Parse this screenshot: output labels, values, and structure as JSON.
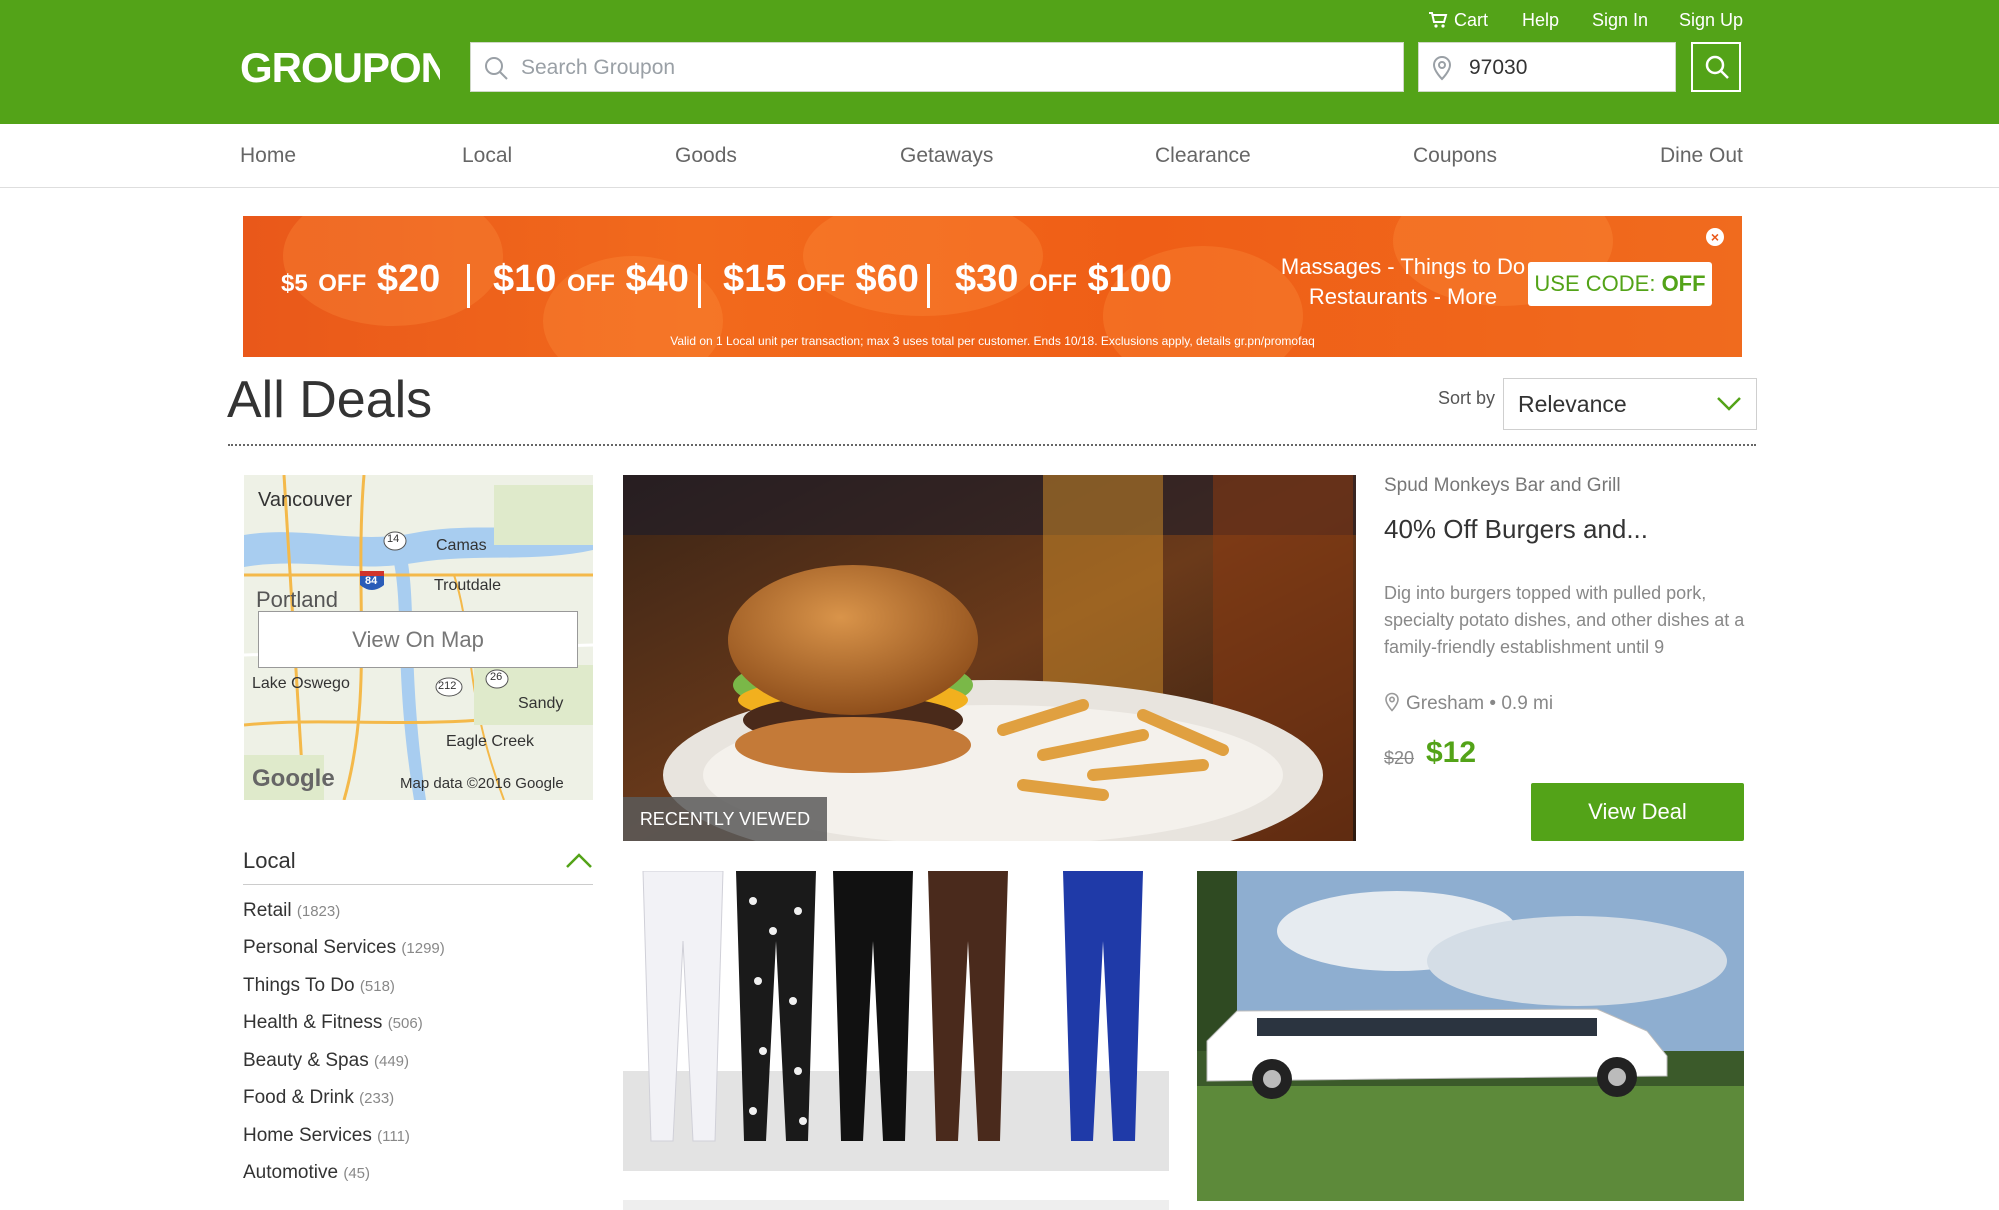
{
  "header": {
    "brand": "GROUPON",
    "cart_label": "Cart",
    "help_label": "Help",
    "signin_label": "Sign In",
    "signup_label": "Sign Up",
    "search_placeholder": "Search Groupon",
    "location_value": "97030",
    "brand_color": "#53a318"
  },
  "nav": {
    "items": [
      "Home",
      "Local",
      "Goods",
      "Getaways",
      "Clearance",
      "Coupons",
      "Dine Out"
    ]
  },
  "banner": {
    "offers": [
      {
        "off": "$5",
        "spend": "$20"
      },
      {
        "off": "$10",
        "spend": "$40"
      },
      {
        "off": "$15",
        "spend": "$60"
      },
      {
        "off": "$30",
        "spend": "$100"
      }
    ],
    "off_word": "OFF",
    "categories_line1": "Massages - Things to Do",
    "categories_line2": "Restaurants - More",
    "code_label": "USE CODE: ",
    "code_value": "OFF",
    "fine_print": "Valid on 1 Local unit per transaction; max 3 uses total per customer. Ends 10/18. Exclusions apply, details gr.pn/promofaq"
  },
  "page": {
    "title": "All Deals",
    "sort_label": "Sort by",
    "sort_value": "Relevance"
  },
  "map": {
    "button_label": "View On Map",
    "attribution": "Map data ©2016 Google",
    "google_logo": "Google",
    "places": [
      "Vancouver",
      "Camas",
      "Portland",
      "Troutdale",
      "Lake Oswego",
      "Sandy",
      "Eagle Creek"
    ],
    "shields": [
      "14",
      "84",
      "212",
      "26"
    ]
  },
  "sidebar": {
    "heading": "Local",
    "categories": [
      {
        "name": "Retail",
        "count": "(1823)"
      },
      {
        "name": "Personal Services",
        "count": "(1299)"
      },
      {
        "name": "Things To Do",
        "count": "(518)"
      },
      {
        "name": "Health & Fitness",
        "count": "(506)"
      },
      {
        "name": "Beauty & Spas",
        "count": "(449)"
      },
      {
        "name": "Food & Drink",
        "count": "(233)"
      },
      {
        "name": "Home Services",
        "count": "(111)"
      },
      {
        "name": "Automotive",
        "count": "(45)"
      }
    ]
  },
  "deal": {
    "badge": "RECENTLY VIEWED",
    "merchant": "Spud Monkeys Bar and Grill",
    "title": "40% Off Burgers and...",
    "description": "Dig into burgers topped with pulled pork, specialty potato dishes, and other dishes at a family-friendly establishment until 9",
    "location": "Gresham • 0.9 mi",
    "original_price": "$20",
    "price": "$12",
    "cta": "View Deal"
  }
}
